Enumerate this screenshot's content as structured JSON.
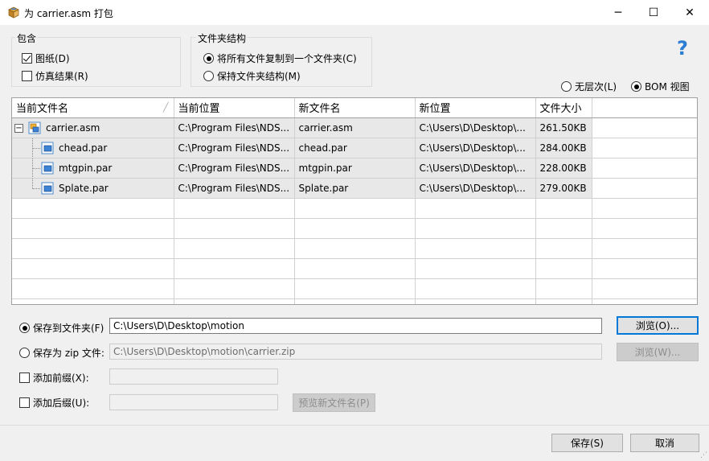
{
  "window": {
    "title": "为 carrier.asm 打包",
    "minimize_glyph": "─",
    "maximize_glyph": "☐",
    "close_glyph": "✕"
  },
  "include_group": {
    "label": "包含",
    "drawings": {
      "label": "图纸(D)",
      "checked": true
    },
    "simulation": {
      "label": "仿真结果(R)",
      "checked": false
    }
  },
  "folder_structure_group": {
    "label": "文件夹结构",
    "copy_all": {
      "label": "将所有文件复制到一个文件夹(C)",
      "selected": true
    },
    "keep_structure": {
      "label": "保持文件夹结构(M)",
      "selected": false
    }
  },
  "view_mode": {
    "flat": {
      "label": "无层次(L)",
      "selected": false
    },
    "bom": {
      "label": "BOM 视图",
      "selected": true
    }
  },
  "help_glyph": "?",
  "grid": {
    "columns": [
      "当前文件名",
      "当前位置",
      "新文件名",
      "新位置",
      "文件大小"
    ],
    "sort_glyph": "╱",
    "expander_glyph": "−",
    "rows": [
      {
        "name": "carrier.asm",
        "location": "C:\\Program Files\\NDS...",
        "new_name": "carrier.asm",
        "new_location": "C:\\Users\\D\\Desktop\\...",
        "size": "261.50KB",
        "level": 0,
        "icon": "assembly-icon"
      },
      {
        "name": "chead.par",
        "location": "C:\\Program Files\\NDS...",
        "new_name": "chead.par",
        "new_location": "C:\\Users\\D\\Desktop\\...",
        "size": "284.00KB",
        "level": 1,
        "icon": "part-icon"
      },
      {
        "name": "mtgpin.par",
        "location": "C:\\Program Files\\NDS...",
        "new_name": "mtgpin.par",
        "new_location": "C:\\Users\\D\\Desktop\\...",
        "size": "228.00KB",
        "level": 1,
        "icon": "part-icon"
      },
      {
        "name": "Splate.par",
        "location": "C:\\Program Files\\NDS...",
        "new_name": "Splate.par",
        "new_location": "C:\\Users\\D\\Desktop\\...",
        "size": "279.00KB",
        "level": 1,
        "icon": "part-icon"
      }
    ]
  },
  "save_to_folder": {
    "label": "保存到文件夹(F)",
    "selected": true,
    "value": "C:\\Users\\D\\Desktop\\motion",
    "browse_label": "浏览(O)..."
  },
  "save_as_zip": {
    "label": "保存为 zip 文件:",
    "selected": false,
    "value": "C:\\Users\\D\\Desktop\\motion\\carrier.zip",
    "browse_label": "浏览(W)..."
  },
  "add_prefix": {
    "label": "添加前缀(X):",
    "checked": false,
    "value": ""
  },
  "add_suffix": {
    "label": "添加后缀(U):",
    "checked": false,
    "value": ""
  },
  "preview_label": "预览新文件名(P)",
  "save_label": "保存(S)",
  "cancel_label": "取消",
  "accent_color": "#0078d7",
  "help_color": "#2b7cd3"
}
